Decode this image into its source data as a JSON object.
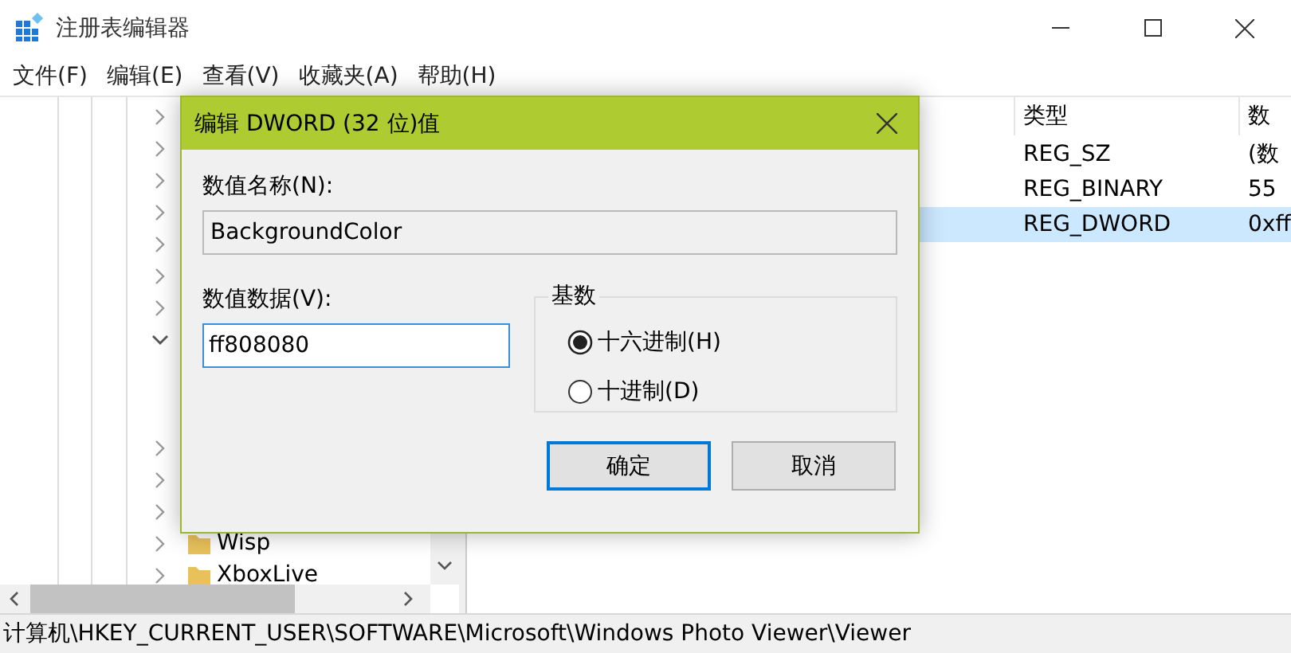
{
  "window": {
    "title": "注册表编辑器"
  },
  "menu": [
    {
      "label": "文件(F)"
    },
    {
      "label": "编辑(E)"
    },
    {
      "label": "查看(V)"
    },
    {
      "label": "收藏夹(A)"
    },
    {
      "label": "帮助(H)"
    }
  ],
  "tree": {
    "items": [
      {
        "expanded": false
      },
      {
        "expanded": false
      },
      {
        "expanded": false
      },
      {
        "expanded": false
      },
      {
        "expanded": false
      },
      {
        "expanded": false
      },
      {
        "expanded": false
      },
      {
        "expanded": true,
        "children": [
          {
            "expanded": false
          },
          {
            "expanded": false
          },
          {
            "expanded": false
          },
          {
            "label": "Wisp",
            "expanded": false
          },
          {
            "label": "XboxLive",
            "expanded": false
          }
        ]
      }
    ]
  },
  "values": {
    "columns": [
      "类型",
      "数"
    ],
    "rows": [
      {
        "type": "REG_SZ",
        "data": "(数",
        "selected": false
      },
      {
        "type": "REG_BINARY",
        "data": "55",
        "selected": false
      },
      {
        "type": "REG_DWORD",
        "data": "0xff",
        "selected": true
      }
    ]
  },
  "dialog": {
    "title": "编辑 DWORD (32 位)值",
    "name_label": "数值名称(N):",
    "name_value": "BackgroundColor",
    "data_label": "数值数据(V):",
    "data_value": "ff808080",
    "base_group": "基数",
    "bases": [
      {
        "label": "十六进制(H)",
        "selected": true
      },
      {
        "label": "十进制(D)",
        "selected": false
      }
    ],
    "buttons": [
      {
        "label": "确定",
        "default": true
      },
      {
        "label": "取消",
        "default": false
      }
    ]
  },
  "status_bar": {
    "path": "计算机\\HKEY_CURRENT_USER\\SOFTWARE\\Microsoft\\Windows Photo Viewer\\Viewer"
  }
}
